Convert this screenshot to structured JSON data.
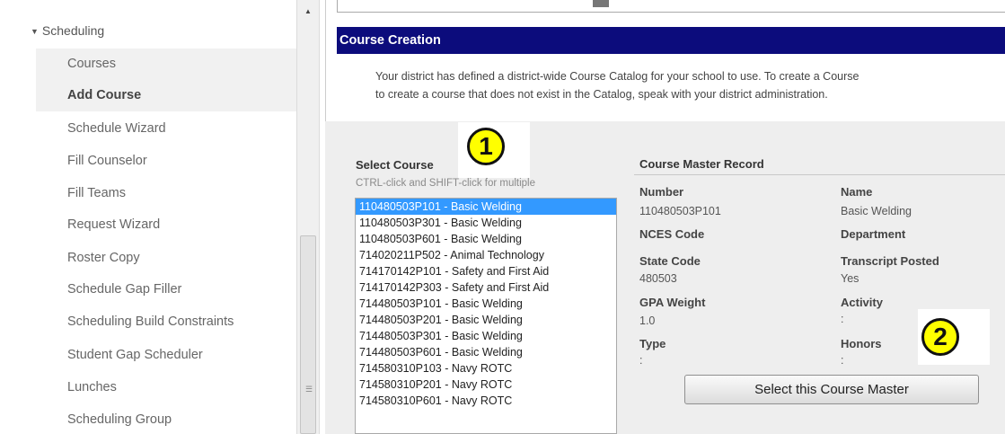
{
  "sidebar": {
    "section": "Scheduling",
    "items": [
      {
        "label": "Courses"
      },
      {
        "label": "Add Course"
      },
      {
        "label": "Schedule Wizard"
      },
      {
        "label": "Fill Counselor"
      },
      {
        "label": "Fill Teams"
      },
      {
        "label": "Request Wizard"
      },
      {
        "label": "Roster Copy"
      },
      {
        "label": "Schedule Gap Filler"
      },
      {
        "label": "Scheduling Build Constraints"
      },
      {
        "label": "Student Gap Scheduler"
      },
      {
        "label": "Lunches"
      },
      {
        "label": "Scheduling Group"
      }
    ]
  },
  "panel": {
    "title": "Course Creation",
    "notice_line1": "Your district has defined a district-wide Course Catalog for your school to use. To create a Course",
    "notice_line2": "to create a course that does not exist in the Catalog, speak with your district administration."
  },
  "select_course": {
    "title": "Select Course",
    "hint": "CTRL-click and SHIFT-click for multiple",
    "options": [
      "110480503P101 - Basic Welding",
      "110480503P301 - Basic Welding",
      "110480503P601 - Basic Welding",
      "714020211P502 - Animal Technology",
      "714170142P101 - Safety and First Aid",
      "714170142P303 - Safety and First Aid",
      "714480503P101 - Basic Welding",
      "714480503P201 - Basic Welding",
      "714480503P301 - Basic Welding",
      "714480503P601 - Basic Welding",
      "714580310P103 - Navy ROTC",
      "714580310P201 - Navy ROTC",
      "714580310P601 - Navy ROTC"
    ],
    "selected_index": 0
  },
  "record": {
    "title": "Course Master Record",
    "number_label": "Number",
    "number_value": "110480503P101",
    "name_label": "Name",
    "name_value": "Basic Welding",
    "nces_label": "NCES Code",
    "department_label": "Department",
    "state_code_label": "State Code",
    "state_code_value": "480503",
    "transcript_label": "Transcript Posted",
    "transcript_value": "Yes",
    "gpa_label": "GPA Weight",
    "gpa_value": "1.0",
    "activity_label": "Activity",
    "activity_value": ":",
    "type_label": "Type",
    "type_value": ":",
    "honors_label": "Honors",
    "honors_value": ":"
  },
  "select_button_label": "Select this Course Master",
  "callouts": [
    "1",
    "2"
  ],
  "colors": {
    "titlebar": "#0c0c7c",
    "selection": "#3399ff",
    "callout": "#ffff00"
  }
}
